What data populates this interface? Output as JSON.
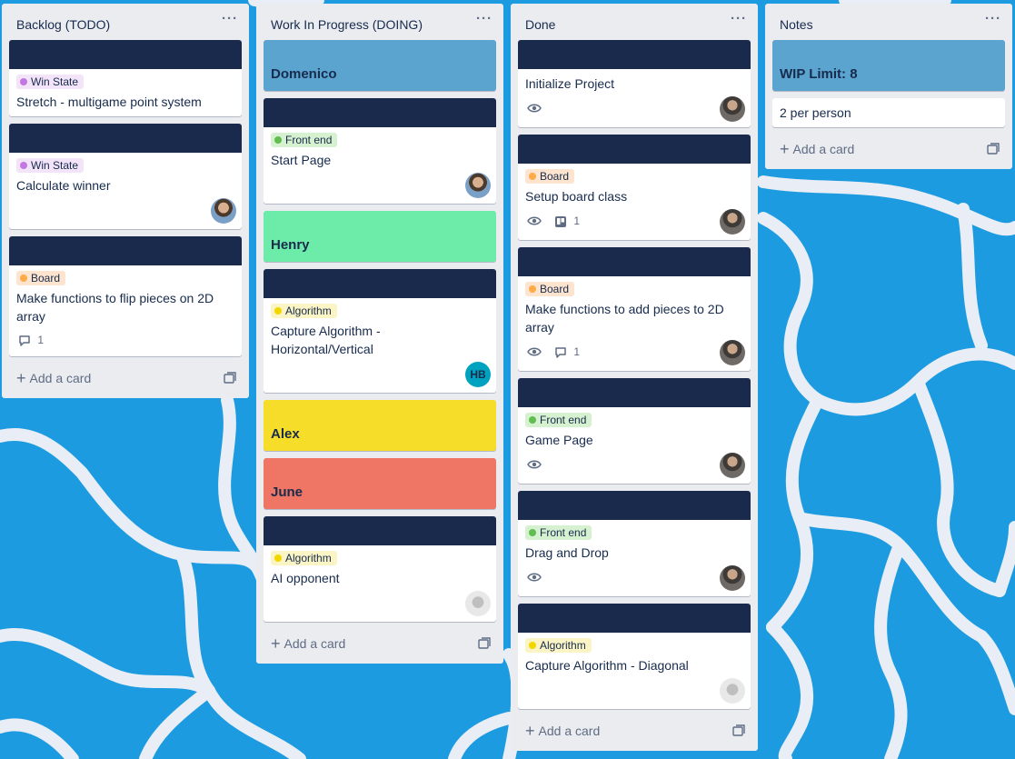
{
  "lists": [
    {
      "title": "Backlog (TODO)",
      "add_card": "Add a card",
      "cards": [
        {
          "label": "Win State",
          "title": "Stretch - multigame point system"
        },
        {
          "label": "Win State",
          "title": "Calculate winner"
        },
        {
          "label": "Board",
          "title": "Make functions to flip pieces on 2D array",
          "comments": "1"
        }
      ]
    },
    {
      "title": "Work In Progress (DOING)",
      "add_card": "Add a card",
      "cards": [
        {
          "name": "Domenico"
        },
        {
          "label": "Front end",
          "title": "Start Page"
        },
        {
          "name": "Henry"
        },
        {
          "label": "Algorithm",
          "title": "Capture Algorithm - Horizontal/Vertical",
          "avatar_initials": "HB"
        },
        {
          "name": "Alex"
        },
        {
          "name": "June"
        },
        {
          "label": "Algorithm",
          "title": "AI opponent"
        }
      ]
    },
    {
      "title": "Done",
      "add_card": "Add a card",
      "cards": [
        {
          "title": "Initialize Project"
        },
        {
          "label": "Board",
          "title": "Setup board class",
          "checklist": "1"
        },
        {
          "label": "Board",
          "title": "Make functions to add pieces to 2D array",
          "comments": "1"
        },
        {
          "label": "Front end",
          "title": "Game Page"
        },
        {
          "label": "Front end",
          "title": "Drag and Drop"
        },
        {
          "label": "Algorithm",
          "title": "Capture Algorithm - Diagonal"
        }
      ]
    },
    {
      "title": "Notes",
      "add_card": "Add a card",
      "cards": [
        {
          "name": "WIP Limit: 8"
        },
        {
          "title": "2 per person"
        }
      ]
    }
  ],
  "colors": {
    "board_bg": "#1d9be0",
    "cover_navy": "#1a2a4c",
    "domenico": "#5ba4cf",
    "henry": "#6deca9",
    "alex": "#f5dd29",
    "june": "#ef7564",
    "wip_limit": "#5ba4cf"
  }
}
